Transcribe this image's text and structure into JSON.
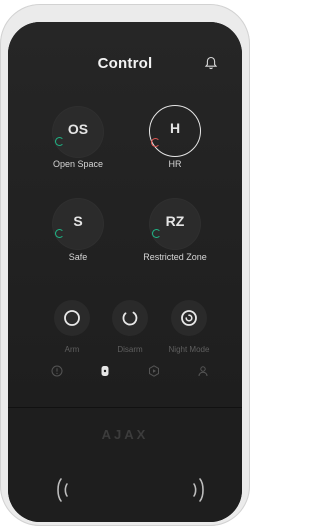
{
  "header": {
    "title": "Control",
    "notification_icon": "bell-icon"
  },
  "groups": [
    {
      "abbr": "OS",
      "label": "Open Space",
      "status_color": "#1fb686",
      "selected": false
    },
    {
      "abbr": "H",
      "label": "HR",
      "status_color": "#e45a56",
      "selected": true
    },
    {
      "abbr": "S",
      "label": "Safe",
      "status_color": "#1fb686",
      "selected": false
    },
    {
      "abbr": "RZ",
      "label": "Restricted Zone",
      "status_color": "#1fb686",
      "selected": false
    }
  ],
  "modes": [
    {
      "label": "Arm",
      "icon": "arm-icon"
    },
    {
      "label": "Disarm",
      "icon": "disarm-icon"
    },
    {
      "label": "Night Mode",
      "icon": "night-mode-icon"
    }
  ],
  "nav": [
    {
      "icon": "alert-icon"
    },
    {
      "icon": "keypad-icon",
      "active": true
    },
    {
      "icon": "scenario-icon"
    },
    {
      "icon": "user-icon"
    }
  ],
  "brand": "AJAX",
  "colors": {
    "accent_green": "#1fb686",
    "accent_red": "#e45a56",
    "panel": "#1b1b1b",
    "shell": "#ebebeb"
  }
}
